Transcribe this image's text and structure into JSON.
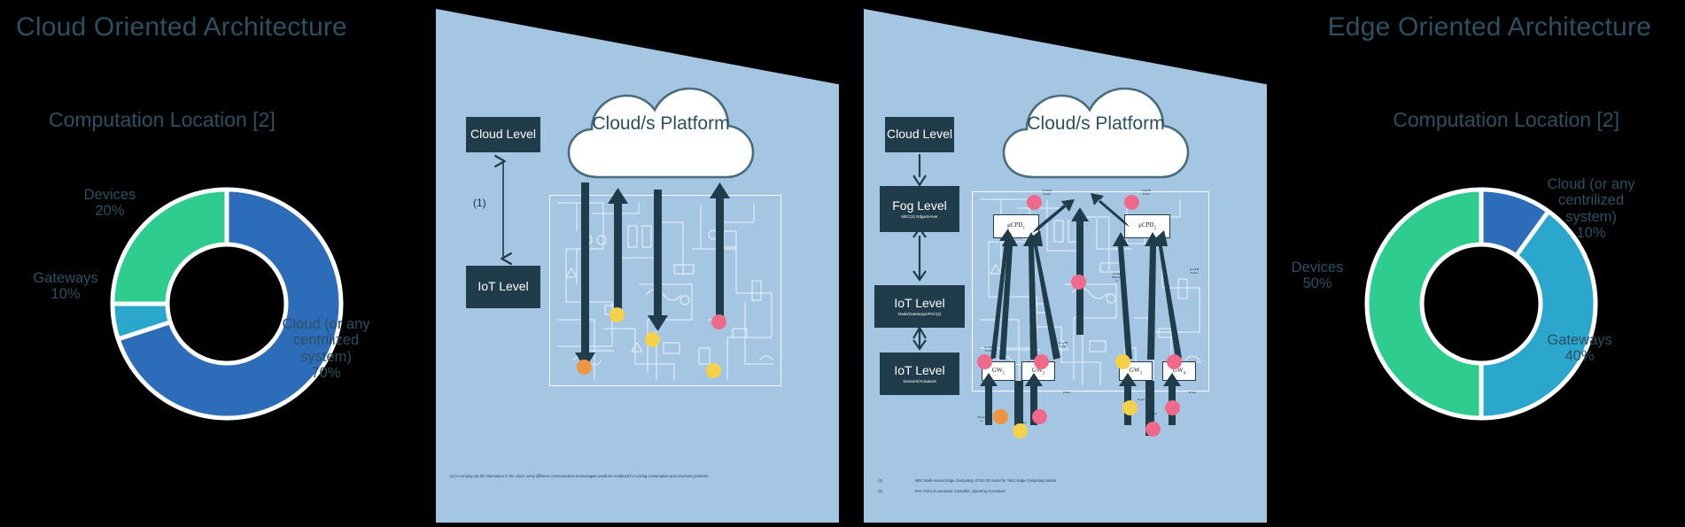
{
  "titles": {
    "left": "Cloud Oriented Architecture",
    "right": "Edge Oriented Architecture",
    "left_subtitle": "Computation Location [2]",
    "right_subtitle": "Computation Location [2]"
  },
  "colors": {
    "title": "#2a5061",
    "panel_bg": "#a4c6e3",
    "box_dark": "#203b4a",
    "blue": "#2d6cb8",
    "teal": "#2ba7ce",
    "green": "#2ecc8f",
    "dot_pink": "#ef6a8a",
    "dot_yellow": "#f5d14a",
    "dot_orange": "#f0953f",
    "stage_bg": "#000000"
  },
  "chart_data": [
    {
      "type": "pie",
      "title": "Computation Location [2]",
      "subtitle": "Cloud Oriented Architecture",
      "categories": [
        "Cloud (or any centrilized system)",
        "Devices",
        "Gateways",
        "Cloud (or any centrilized system)"
      ],
      "labels": [
        "Cloud (or any centrilized system)\n70%",
        "Devices\n20%",
        "Gateways\n10%"
      ],
      "slices": [
        {
          "name": "Cloud (or any centrilized system)",
          "value": 70,
          "color": "#2d6cb8"
        },
        {
          "name": "Gateways",
          "value": 10,
          "color": "#2ba7ce"
        },
        {
          "name": "Devices",
          "value": 20,
          "color": "#2ecc8f"
        }
      ],
      "values": [
        70,
        10,
        20
      ],
      "legend": "labels-outside",
      "hole": 0.5
    },
    {
      "type": "pie",
      "title": "Computation Location [2]",
      "subtitle": "Edge Oriented Architecture",
      "categories": [
        "Cloud (or any centrilized system)",
        "Gateways",
        "Devices"
      ],
      "labels": [
        "Cloud (or any centrilized\nsystem)\n10%",
        "Gateways\n40%",
        "Devices\n50%"
      ],
      "slices": [
        {
          "name": "Cloud (or any centrilized system)",
          "value": 10,
          "color": "#2d6cb8"
        },
        {
          "name": "Gateways",
          "value": 40,
          "color": "#2ba7ce"
        },
        {
          "name": "Devices",
          "value": 50,
          "color": "#2ecc8f"
        }
      ],
      "values": [
        10,
        40,
        50
      ],
      "legend": "labels-outside",
      "hole": 0.5
    }
  ],
  "donut_left": {
    "devices_label": "Devices\n20%",
    "gateways_label": "Gateways\n10%",
    "cloud_label": "Cloud (or any\ncentrilized\nsystem)\n70%"
  },
  "donut_right": {
    "cloud_label": "Cloud (or any\ncentrilized\nsystem)\n10%",
    "devices_label": "Devices\n50%",
    "gateways_label": "Gateways\n40%"
  },
  "panel1": {
    "cloud_text": "Cloud/s\nPlatform",
    "boxes": [
      {
        "title": "Cloud\nLevel",
        "sub": ""
      },
      {
        "title": "IoT Level",
        "sub": ""
      }
    ],
    "annotation": "(1)",
    "footnote": "(1) In carrying out the information to the cloud, many different communication technologies would be combined for solving consumption and  coverture problems"
  },
  "panel2": {
    "cloud_text": "Cloud/s\nPlatform",
    "boxes": [
      {
        "title": "Cloud\nLevel",
        "sub": ""
      },
      {
        "title": "Fog Level",
        "sub": "MEC(1) EdgeServer"
      },
      {
        "title": "IoT Level",
        "sub": "Node/Gateways/PAC(2)"
      },
      {
        "title": "IoT Level",
        "sub": "Sensors/Actuators"
      }
    ],
    "mini_boxes": [
      {
        "label": "μCPD",
        "index": "1"
      },
      {
        "label": "μCPD",
        "index": "2"
      },
      {
        "label": "GW",
        "index": "1"
      },
      {
        "label": "GW",
        "index": "2"
      },
      {
        "label": "GW",
        "index": "3"
      },
      {
        "label": "GW",
        "index": "4"
      }
    ],
    "micro_labels": [
      "F-GLB\nEvent",
      "F-GLB\nEvent",
      "G-GLB\nEvent",
      "G-GLB\nEvent",
      "G-GLB\nEvent",
      "Event",
      "Event",
      "Event",
      "Event",
      "G-GLB\nBinarios\nrx",
      "Measu\nre",
      "Measu\nre"
    ],
    "footnotes": [
      {
        "num": "(1)",
        "text": "MEC Multi-Access Edge Computing. ETSI-CE model for Telco Edge Computing market"
      },
      {
        "num": "(2)",
        "text": "PAC Point of Automatic  Controller, OpenFog Consotium"
      }
    ]
  }
}
